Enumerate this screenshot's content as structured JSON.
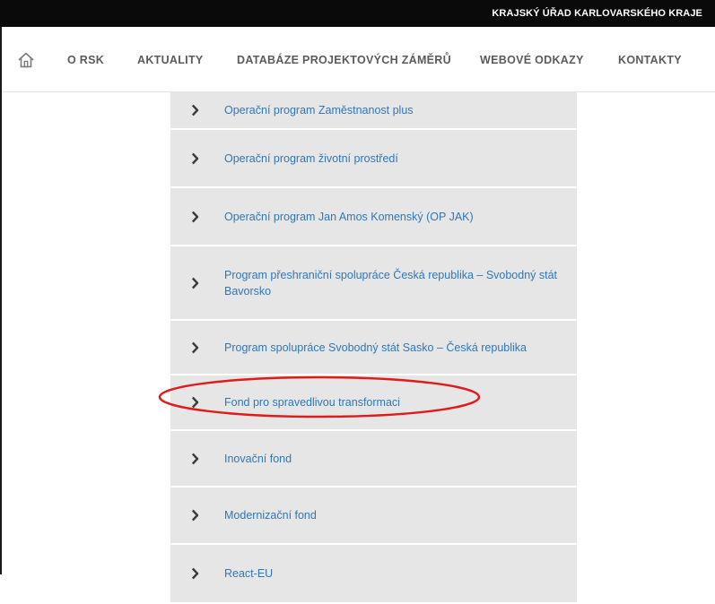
{
  "header": {
    "title": "KRAJSKÝ ÚŘAD KARLOVARSKÉHO KRAJE"
  },
  "nav": {
    "home_icon": "home-icon",
    "items": [
      {
        "label": "O RSK"
      },
      {
        "label": "AKTUALITY"
      },
      {
        "label": "DATABÁZE PROJEKTOVÝCH ZÁMĚRŮ"
      },
      {
        "label": "WEBOVÉ ODKAZY"
      },
      {
        "label": "KONTAKTY"
      }
    ]
  },
  "programs": {
    "chevron_icon": "chevron-right-icon",
    "items": [
      {
        "label": "Operační program Zaměstnanost plus"
      },
      {
        "label": "Operační program životní prostředí"
      },
      {
        "label": "Operační program Jan Amos Komenský (OP JAK)"
      },
      {
        "label": "Program přeshraniční spolupráce Česká republika – Svobodný stát Bavorsko"
      },
      {
        "label": "Program spolupráce Svobodný stát Sasko – Česká republika"
      },
      {
        "label": "Fond pro spravedlivou transformaci"
      },
      {
        "label": "Inovační fond"
      },
      {
        "label": "Modernizační fond"
      },
      {
        "label": "React-EU"
      }
    ]
  },
  "annotation": {
    "color": "#e01b1b",
    "target": "Fond pro spravedlivou transformaci"
  },
  "colors": {
    "link": "#2f77b8",
    "item_bg": "#e6e6e6",
    "topbar": "#0a0a0a",
    "nav_text": "#5b5b5b"
  }
}
